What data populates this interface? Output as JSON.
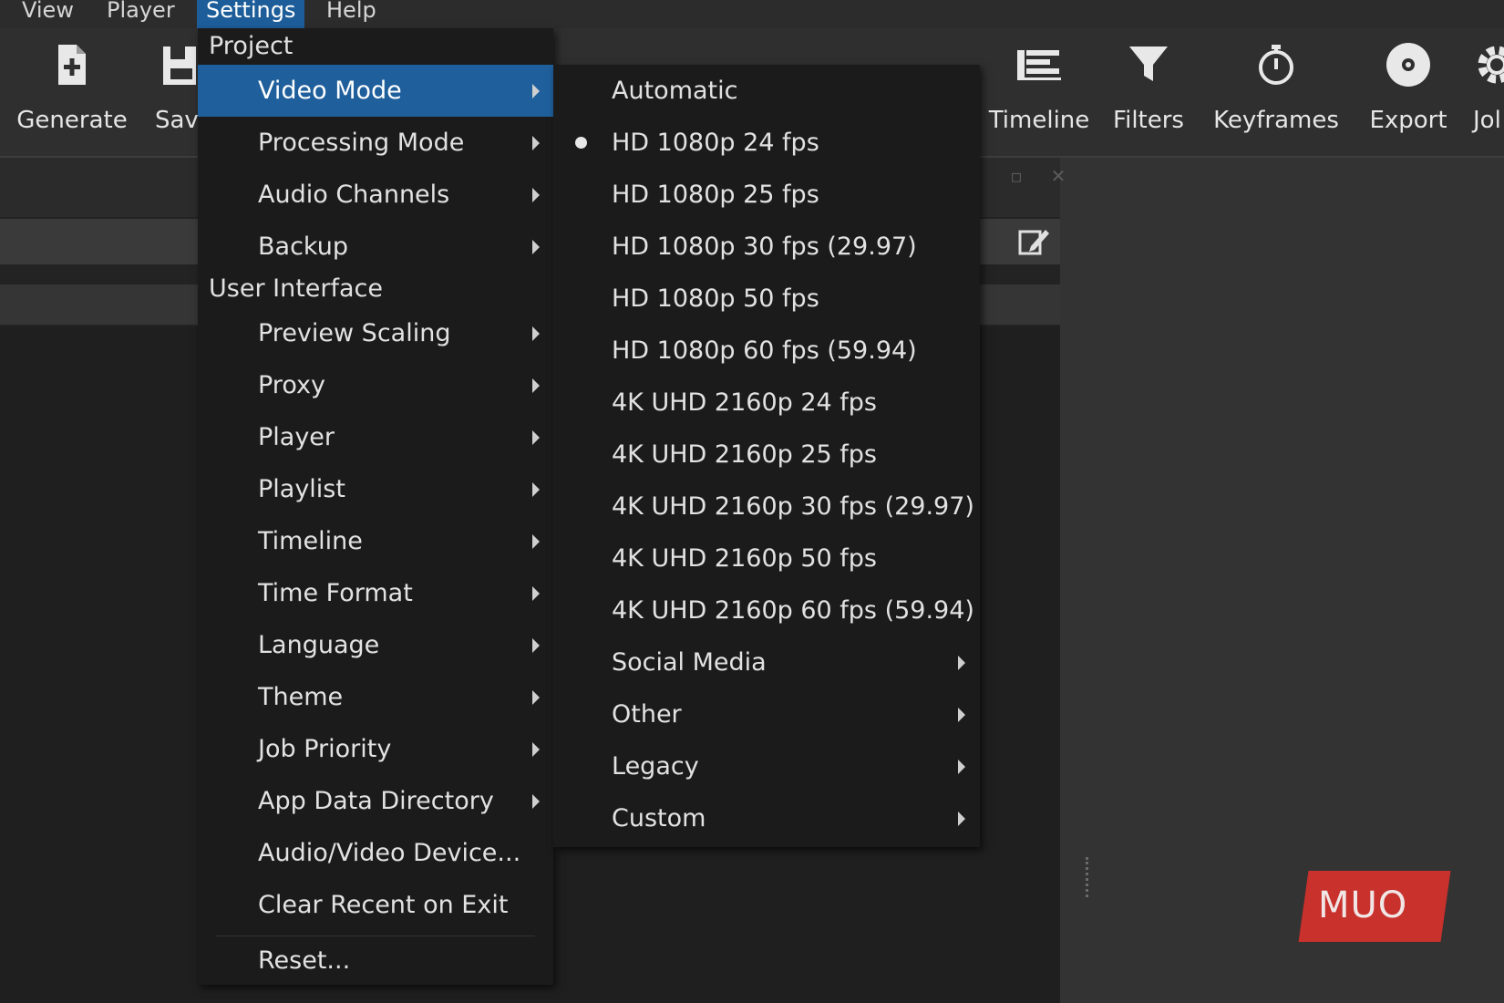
{
  "menubar": {
    "items": [
      {
        "label": "View"
      },
      {
        "label": "Player"
      },
      {
        "label": "Settings"
      },
      {
        "label": "Help"
      }
    ]
  },
  "toolbar": {
    "generate_label": "Generate",
    "save_label": "Sav",
    "timeline_label": "Timeline",
    "filters_label": "Filters",
    "keyframes_label": "Keyframes",
    "export_label": "Export",
    "jobs_label": "Jol"
  },
  "settings_menu": {
    "section_project": "Project",
    "section_ui": "User Interface",
    "items": [
      {
        "label": "Video Mode",
        "submenu": true,
        "highlighted": true
      },
      {
        "label": "Processing Mode",
        "submenu": true
      },
      {
        "label": "Audio Channels",
        "submenu": true
      },
      {
        "label": "Backup",
        "submenu": true
      },
      {
        "label": "Preview Scaling",
        "submenu": true
      },
      {
        "label": "Proxy",
        "submenu": true
      },
      {
        "label": "Player",
        "submenu": true
      },
      {
        "label": "Playlist",
        "submenu": true
      },
      {
        "label": "Timeline",
        "submenu": true
      },
      {
        "label": "Time Format",
        "submenu": true
      },
      {
        "label": "Language",
        "submenu": true
      },
      {
        "label": "Theme",
        "submenu": true
      },
      {
        "label": "Job Priority",
        "submenu": true
      },
      {
        "label": "App Data Directory",
        "submenu": true
      },
      {
        "label": "Audio/Video Device...",
        "submenu": false
      },
      {
        "label": "Clear Recent on Exit",
        "submenu": false
      },
      {
        "label": "Reset...",
        "submenu": false
      }
    ]
  },
  "video_mode_menu": {
    "items": [
      {
        "label": "Automatic",
        "selected": false,
        "submenu": false
      },
      {
        "label": "HD 1080p 24 fps",
        "selected": true,
        "submenu": false
      },
      {
        "label": "HD 1080p 25 fps",
        "selected": false,
        "submenu": false
      },
      {
        "label": "HD 1080p 30 fps (29.97)",
        "selected": false,
        "submenu": false
      },
      {
        "label": "HD 1080p 50 fps",
        "selected": false,
        "submenu": false
      },
      {
        "label": "HD 1080p 60 fps (59.94)",
        "selected": false,
        "submenu": false
      },
      {
        "label": "4K UHD 2160p 24 fps",
        "selected": false,
        "submenu": false
      },
      {
        "label": "4K UHD 2160p 25 fps",
        "selected": false,
        "submenu": false
      },
      {
        "label": "4K UHD 2160p 30 fps (29.97)",
        "selected": false,
        "submenu": false
      },
      {
        "label": "4K UHD 2160p 50 fps",
        "selected": false,
        "submenu": false
      },
      {
        "label": "4K UHD 2160p 60 fps (59.94)",
        "selected": false,
        "submenu": false
      },
      {
        "label": "Social Media",
        "selected": false,
        "submenu": true
      },
      {
        "label": "Other",
        "selected": false,
        "submenu": true
      },
      {
        "label": "Legacy",
        "selected": false,
        "submenu": true
      },
      {
        "label": "Custom",
        "selected": false,
        "submenu": true
      }
    ]
  },
  "watermark": {
    "text": "MUO"
  },
  "colors": {
    "highlight": "#1f5f9c",
    "menu_bg": "#1b1b1b",
    "logo": "#c8312c"
  }
}
